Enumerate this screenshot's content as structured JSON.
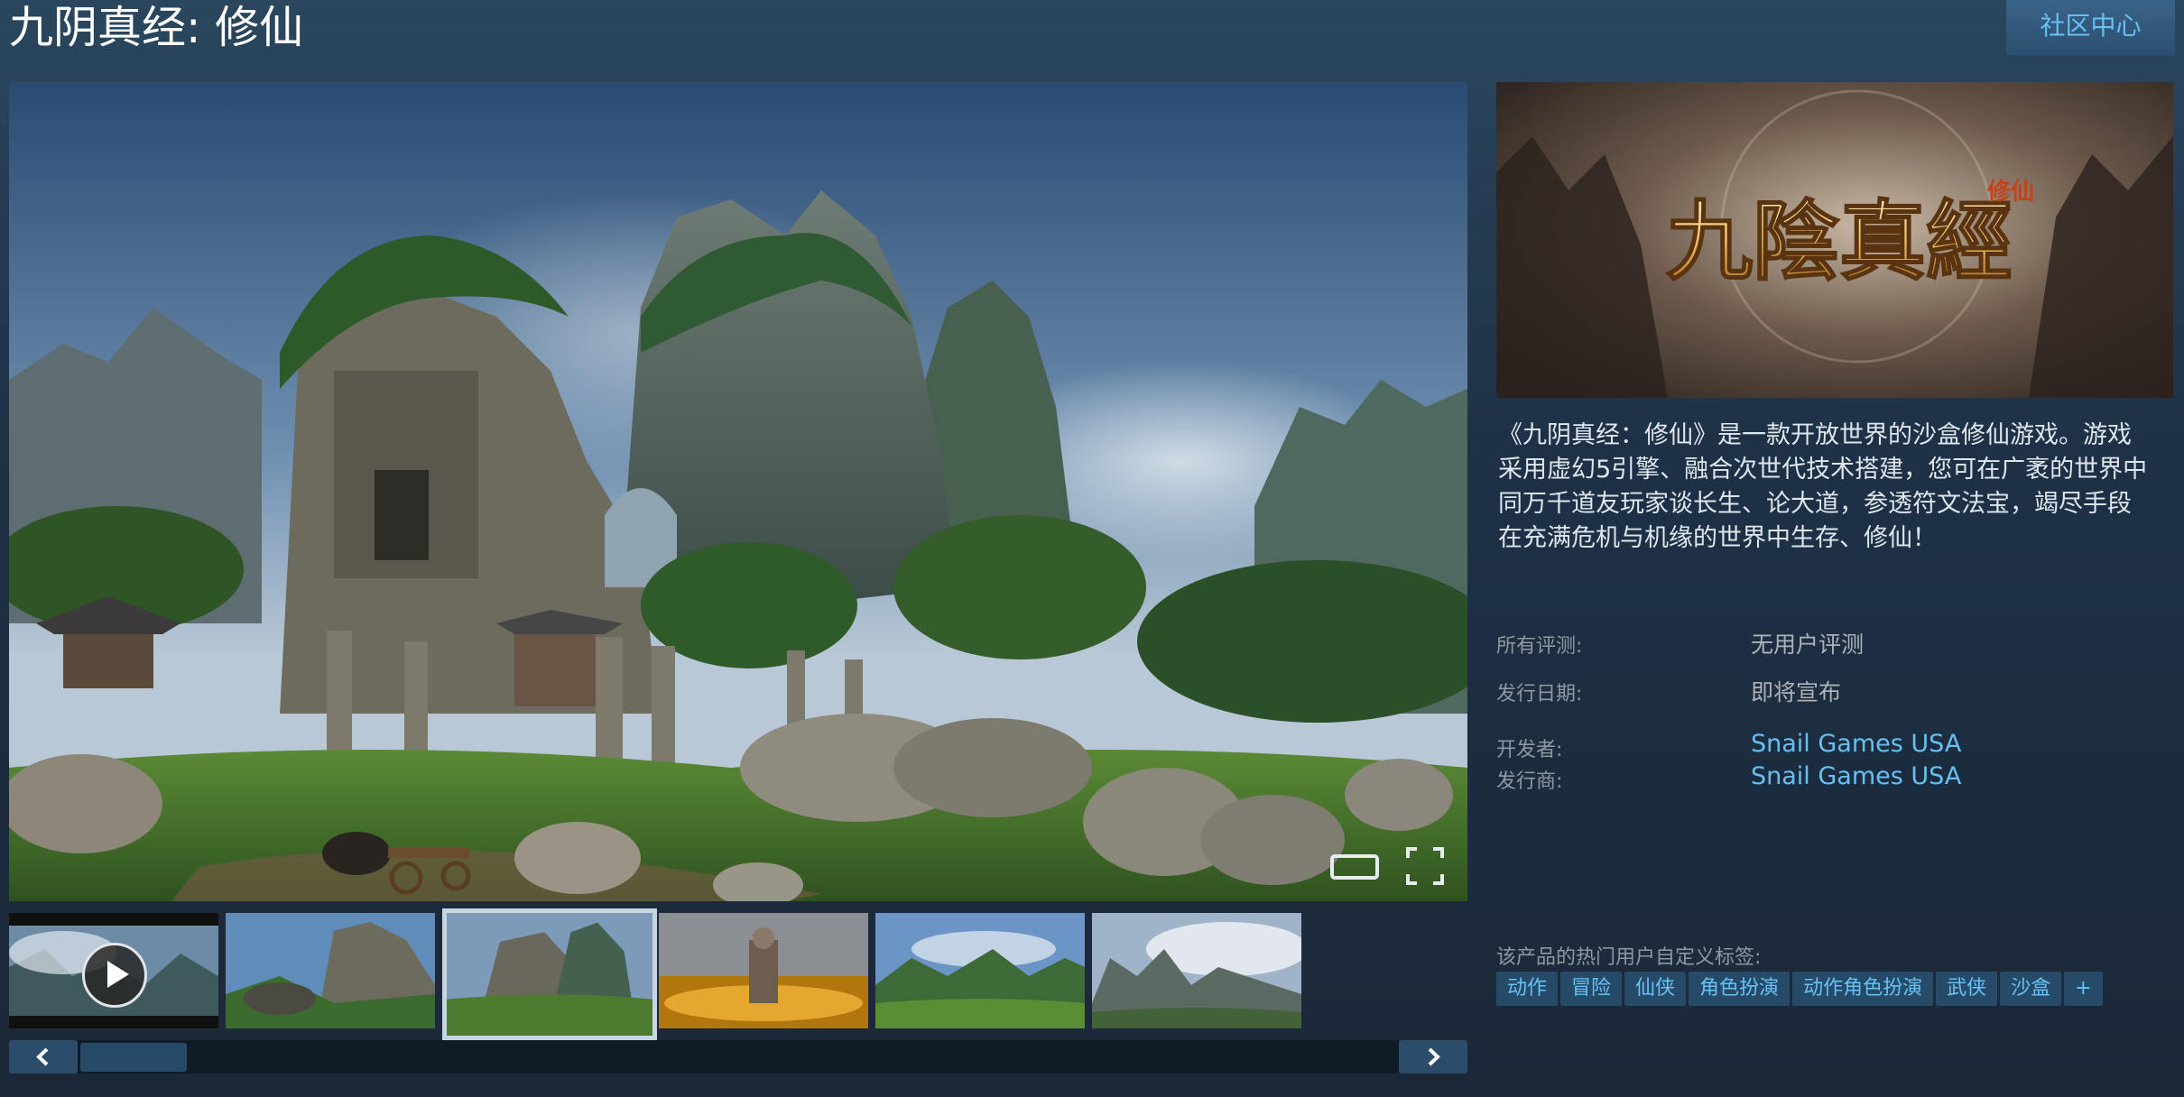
{
  "header": {
    "title": "九阴真经: 修仙",
    "community_button": "社区中心"
  },
  "media": {
    "thumbnails": [
      {
        "kind": "video",
        "icon": "play-icon"
      },
      {
        "kind": "screenshot"
      },
      {
        "kind": "screenshot",
        "selected": true
      },
      {
        "kind": "screenshot"
      },
      {
        "kind": "screenshot"
      },
      {
        "kind": "screenshot"
      }
    ],
    "prev_label": "‹",
    "next_label": "›"
  },
  "capsule": {
    "logo_text": "九陰真經",
    "logo_small": "修仙"
  },
  "description": "《九阴真经：修仙》是一款开放世界的沙盒修仙游戏。游戏采用虚幻5引擎、融合次世代技术搭建，您可在广袤的世界中同万千道友玩家谈长生、论大道，参透符文法宝，竭尽手段在充满危机与机缘的世界中生存、修仙！",
  "info": {
    "reviews_label": "所有评测:",
    "reviews_value": "无用户评测",
    "release_label": "发行日期:",
    "release_value": "即将宣布",
    "developer_label": "开发者:",
    "developer_value": "Snail Games USA",
    "publisher_label": "发行商:",
    "publisher_value": "Snail Games USA"
  },
  "tags": {
    "label": "该产品的热门用户自定义标签:",
    "items": [
      "动作",
      "冒险",
      "仙侠",
      "角色扮演",
      "动作角色扮演",
      "武侠",
      "沙盒",
      "+"
    ]
  }
}
